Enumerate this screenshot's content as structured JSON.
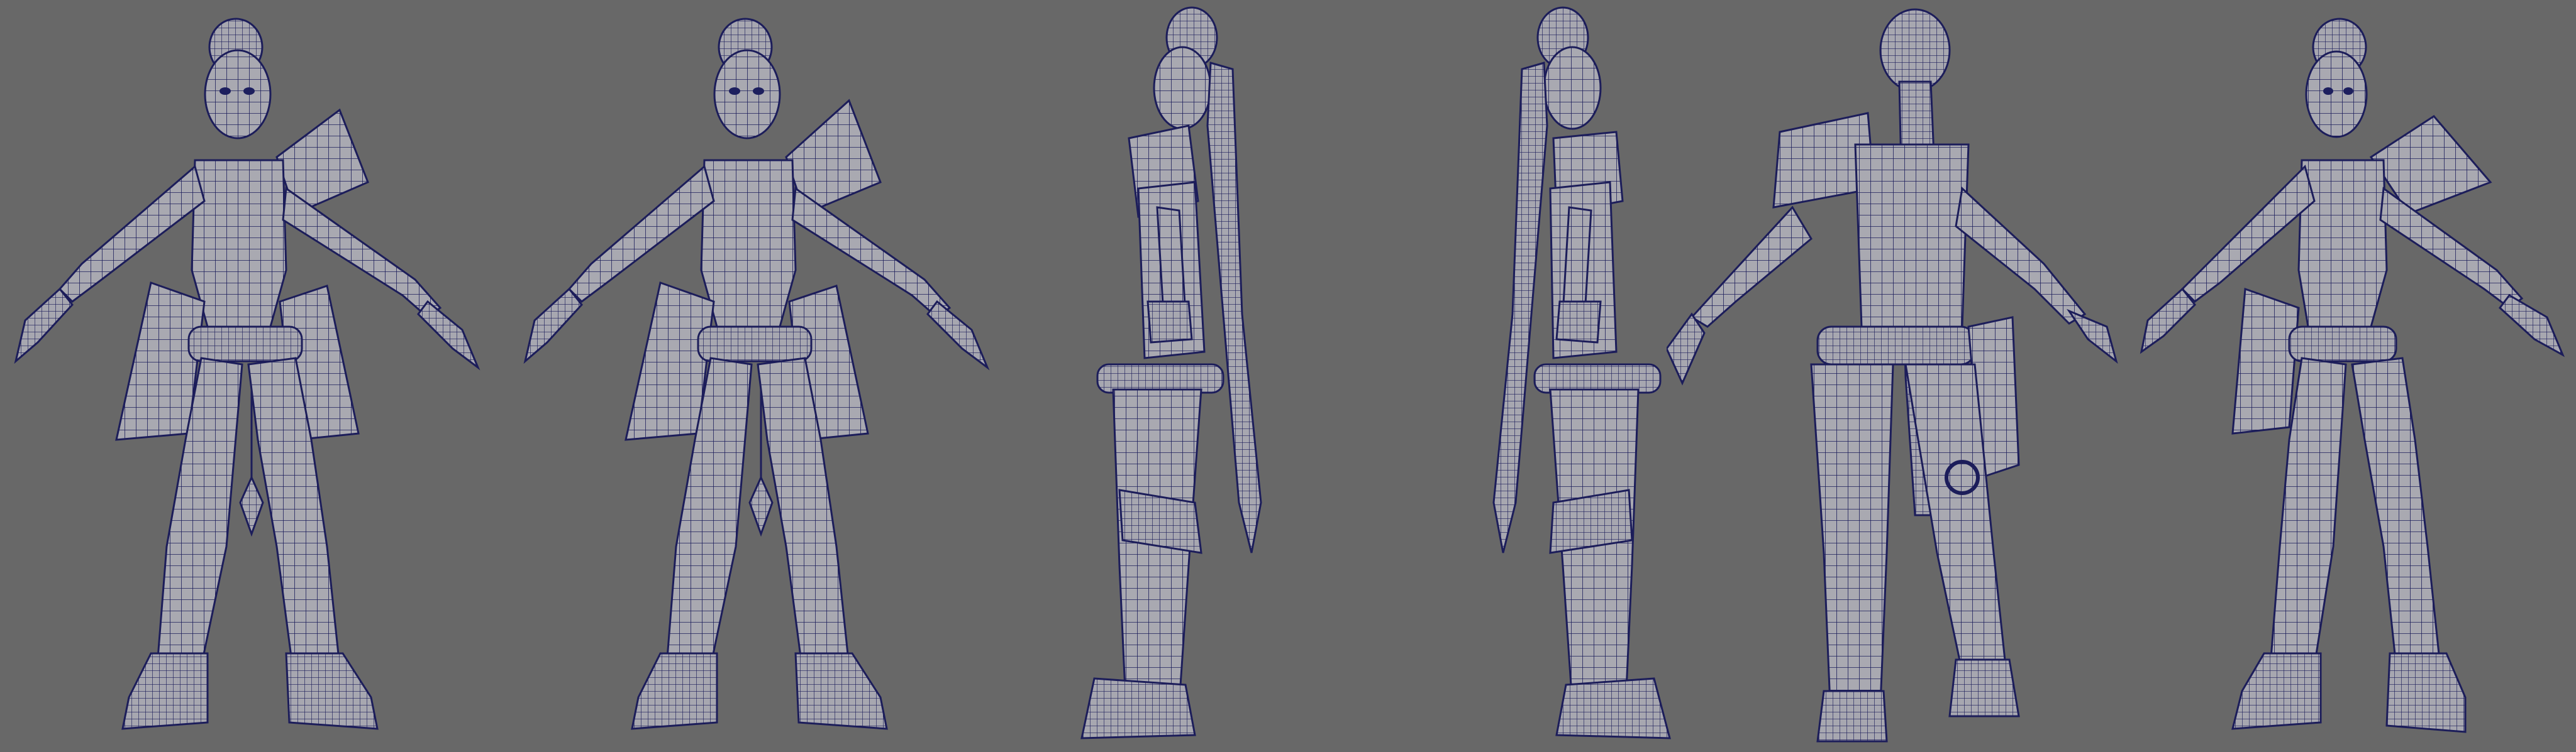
{
  "scene": {
    "background_color": "#686868",
    "mesh_fill_color": "#a9a9b1",
    "wire_color": "#1c1d5a",
    "views": [
      {
        "name": "front-wireframe"
      },
      {
        "name": "front-wireframe-duplicate"
      },
      {
        "name": "side-right-wireframe"
      },
      {
        "name": "side-left-wireframe"
      },
      {
        "name": "back-three-quarter-wireframe"
      },
      {
        "name": "front-three-quarter-wireframe"
      }
    ]
  }
}
